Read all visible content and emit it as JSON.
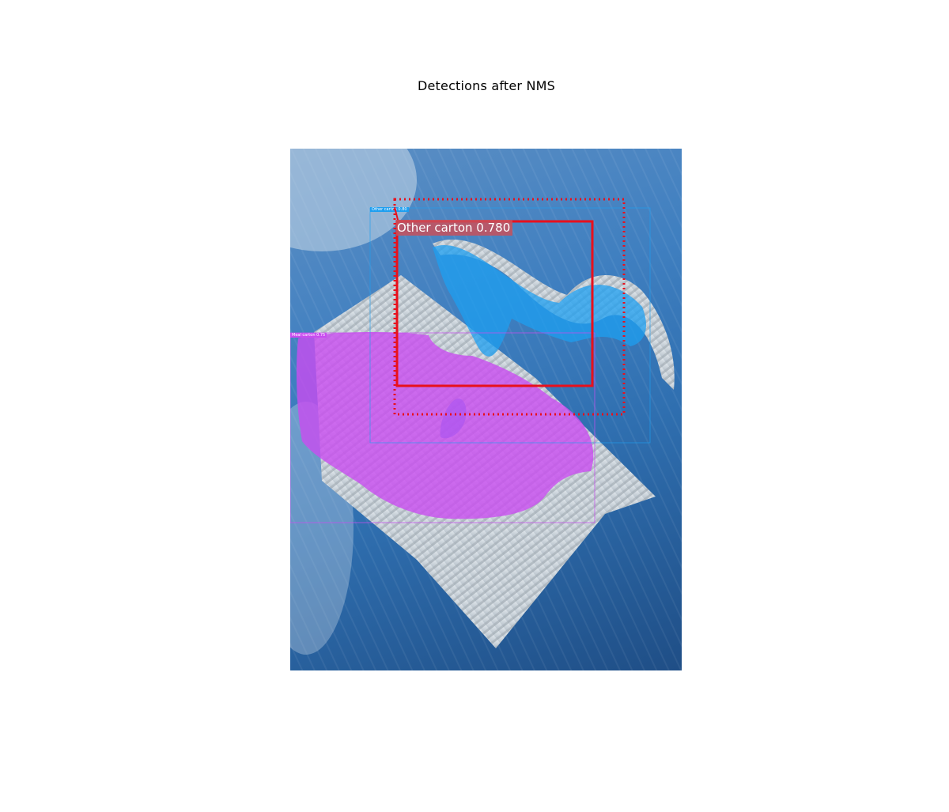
{
  "figure": {
    "title": "Detections after NMS"
  },
  "detections": {
    "primary_label": "Other carton 0.780",
    "small_label_cyan": "Other carton 0.80",
    "small_label_magenta": "Meal carton 0.75"
  },
  "colors": {
    "primary_box": "#e8101c",
    "cyan_mask": "#1e9ff0",
    "magenta_mask": "#c94cf0",
    "background_blue": "#2f6fb0"
  }
}
